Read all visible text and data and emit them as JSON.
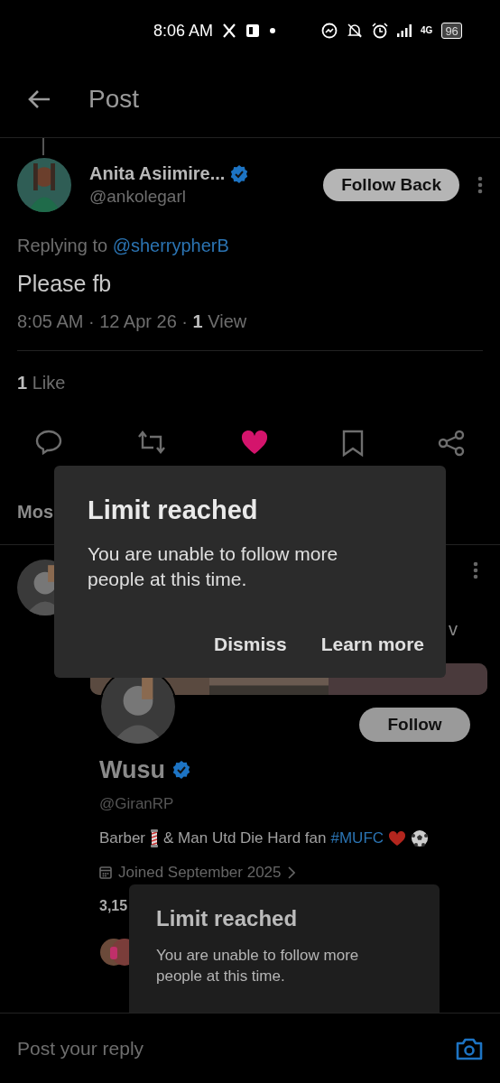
{
  "status_bar": {
    "time": "8:06 AM",
    "network": "4G",
    "battery": "96"
  },
  "header": {
    "title": "Post"
  },
  "post": {
    "author": {
      "name": "Anita Asiimire...",
      "handle": "@ankolegarl",
      "verified": true
    },
    "follow_button": "Follow Back",
    "replying_to_label": "Replying to",
    "replying_to": "@sherrypherB",
    "text": "Please fb",
    "meta": "8:05 AM · 12 Apr 26 · **1** View",
    "likes": "**1** Like",
    "liked": true,
    "bookmarked": false
  },
  "replies_sort": "Mos",
  "reply": {
    "fragment": "v"
  },
  "profile_card": {
    "name": "Wusu",
    "verified": true,
    "handle": "@GiranRP",
    "follow_button": "Follow",
    "bio_start": "Barber",
    "bio_middle": "& Man Utd Die Hard fan",
    "hashtag": "#MUFC",
    "joined": "Joined September 2025",
    "stats_fragment": "3,15"
  },
  "snackbars": [
    {
      "title": "Limit reached",
      "message": "You are unable to follow more people at this time.",
      "dimmed": false,
      "actions": [
        "Dismiss",
        "Learn more"
      ]
    },
    {
      "title": "Limit reached",
      "message": "You are unable to follow more people at this time.",
      "dimmed": true
    }
  ],
  "composer": {
    "placeholder": "Post your reply"
  }
}
